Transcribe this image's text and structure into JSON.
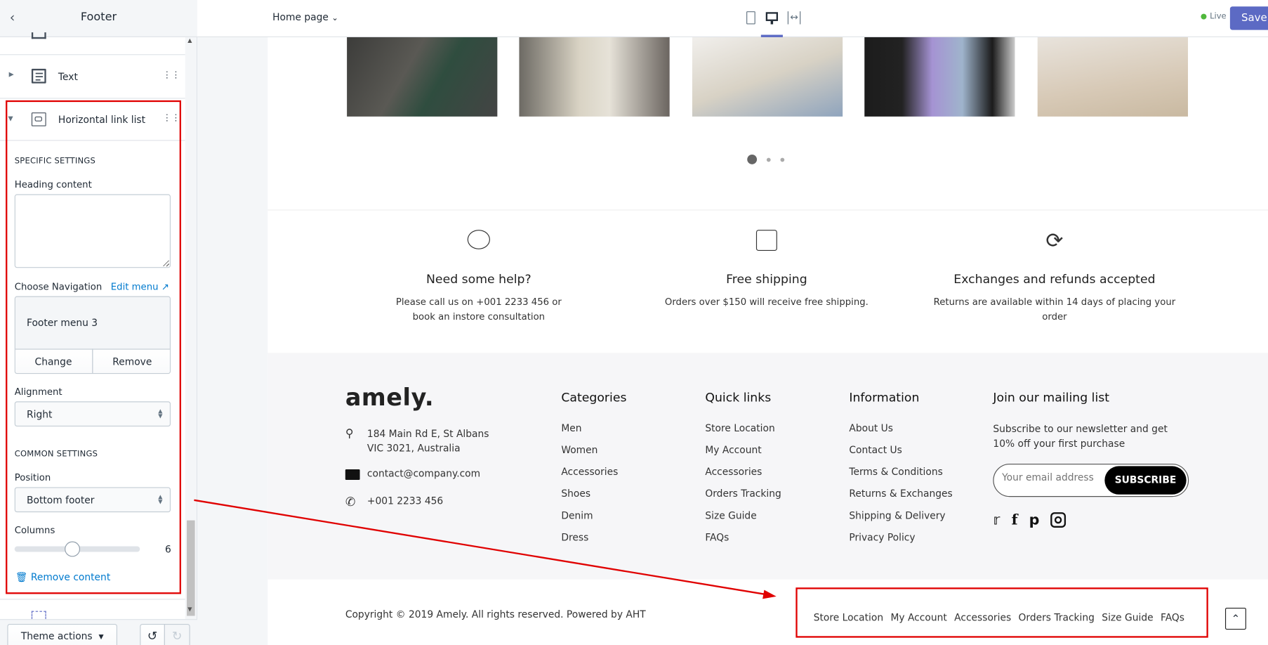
{
  "sidebar": {
    "title": "Footer",
    "items": [
      {
        "label": "Text"
      },
      {
        "label": "Horizontal link list"
      }
    ],
    "specific_settings": "SPECIFIC SETTINGS",
    "heading_content_label": "Heading content",
    "heading_content_value": "",
    "choose_navigation": "Choose Navigation",
    "edit_menu": "Edit menu",
    "selected_menu": "Footer menu 3",
    "change": "Change",
    "remove": "Remove",
    "alignment_label": "Alignment",
    "alignment_value": "Right",
    "common_settings": "COMMON SETTINGS",
    "position_label": "Position",
    "position_value": "Bottom footer",
    "columns_label": "Columns",
    "columns_value": "6",
    "columns_min": 1,
    "columns_max": 12,
    "remove_content": "Remove content",
    "theme_actions": "Theme actions"
  },
  "topbar": {
    "page_select": "Home page",
    "devices": [
      "mobile",
      "desktop",
      "full-width"
    ],
    "active_device": "desktop",
    "status": "Live",
    "save": "Save",
    "accent": "#5c6ac4",
    "live_color": "#50b83c"
  },
  "carousel": {
    "slides": 3,
    "active": 1
  },
  "features": [
    {
      "icon": "chat-bubble-icon",
      "title": "Need some help?",
      "text": "Please call us on +001 2233 456 or book an instore consultation"
    },
    {
      "icon": "box-icon",
      "title": "Free shipping",
      "text": "Orders over $150 will receive free shipping."
    },
    {
      "icon": "refresh-icon",
      "title": "Exchanges and refunds accepted",
      "text": "Returns are available within 14 days of placing your order"
    }
  ],
  "footer": {
    "logo": "amely.",
    "address1": "184 Main Rd E, St Albans",
    "address2": "VIC 3021, Australia",
    "email": "contact@company.com",
    "phone": "+001 2233 456",
    "columns": [
      {
        "title": "Categories",
        "links": [
          "Men",
          "Women",
          "Accessories",
          "Shoes",
          "Denim",
          "Dress"
        ]
      },
      {
        "title": "Quick links",
        "links": [
          "Store Location",
          "My Account",
          "Accessories",
          "Orders Tracking",
          "Size Guide",
          "FAQs"
        ]
      },
      {
        "title": "Information",
        "links": [
          "About Us",
          "Contact Us",
          "Terms & Conditions",
          "Returns & Exchanges",
          "Shipping & Delivery",
          "Privacy Policy"
        ]
      }
    ],
    "newsletter": {
      "title": "Join our mailing list",
      "text1": "Subscribe to our newsletter and get",
      "text2": "10% off your first purchase",
      "placeholder": "Your email address",
      "button": "SUBSCRIBE"
    },
    "social": [
      "twitter-icon",
      "facebook-icon",
      "pinterest-icon",
      "instagram-icon"
    ],
    "copyright": "Copyright © 2019 Amely. All rights reserved. Powered by AHT",
    "bottom_links": [
      "Store Location",
      "My Account",
      "Accessories",
      "Orders Tracking",
      "Size Guide",
      "FAQs"
    ]
  },
  "annotation_color": "#e00000"
}
